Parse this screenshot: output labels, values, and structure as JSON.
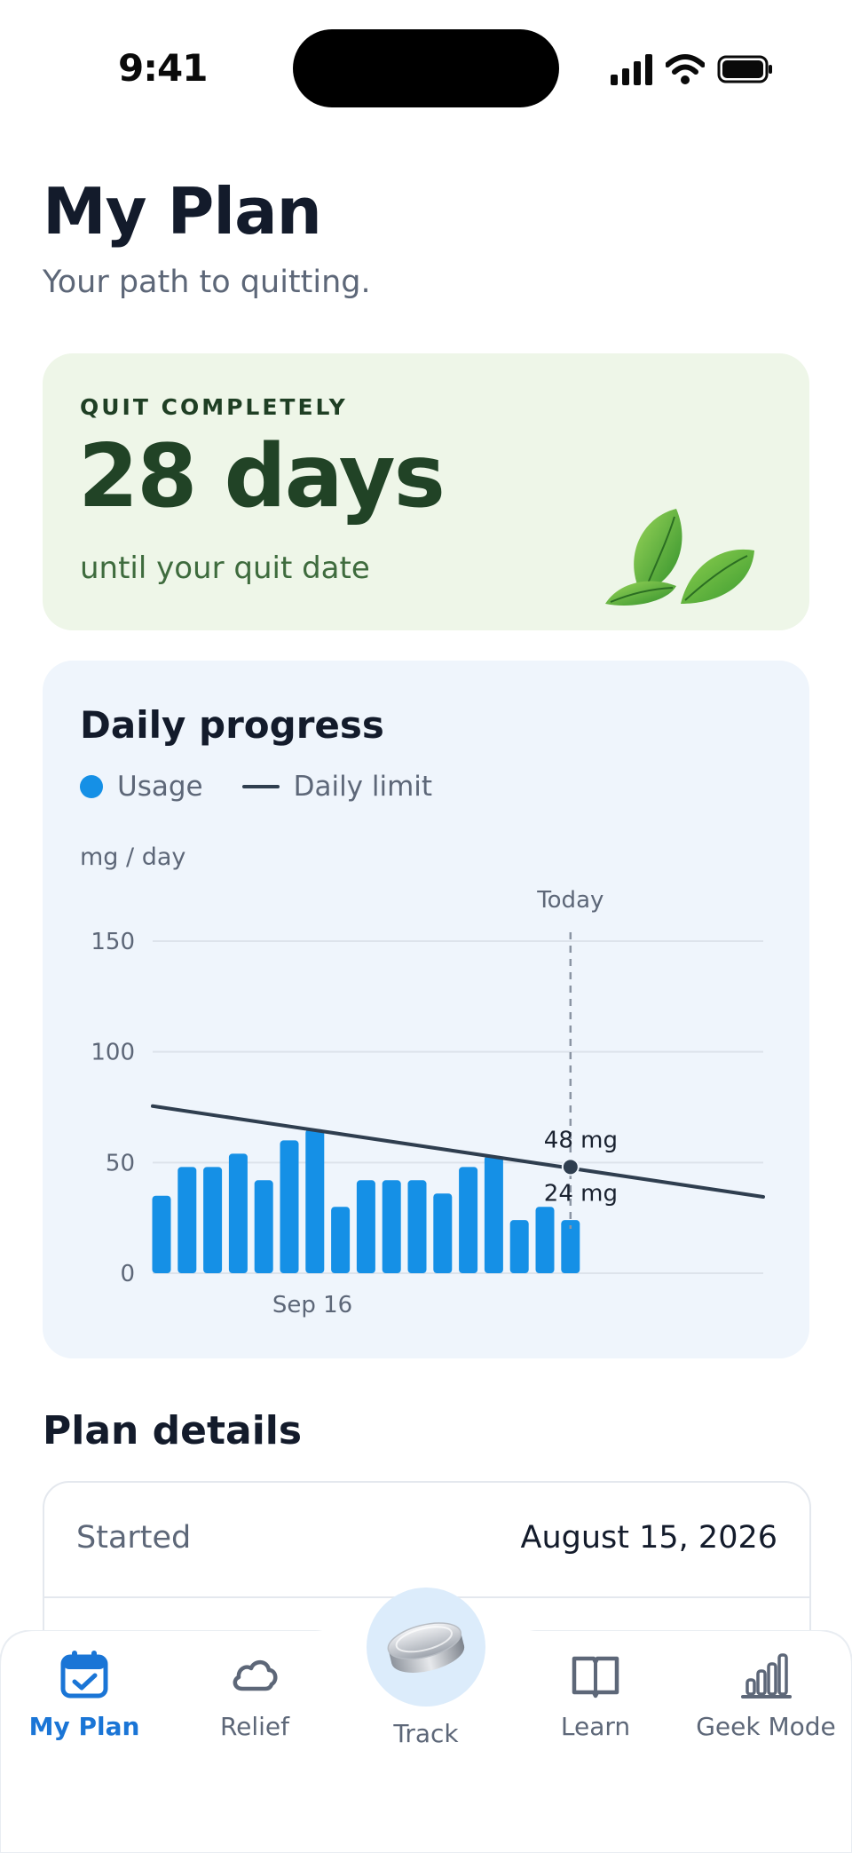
{
  "status_bar": {
    "time": "9:41"
  },
  "header": {
    "title": "My Plan",
    "subtitle": "Your path to quitting."
  },
  "quit_card": {
    "eyebrow": "QUIT COMPLETELY",
    "days": "28 days",
    "caption": "until your quit date",
    "icon": "leaves-icon"
  },
  "progress_card": {
    "title": "Daily progress",
    "legend_usage": "Usage",
    "legend_limit": "Daily limit",
    "unit_label": "mg / day"
  },
  "chart_data": {
    "type": "bar",
    "title": "Daily progress",
    "ylabel": "mg / day",
    "ylim": [
      0,
      150
    ],
    "yticks": [
      0,
      50,
      100,
      150
    ],
    "x_tick_label": "Sep 16",
    "x_tick_index": 5,
    "today_label": "Today",
    "today_index": 16,
    "series": [
      {
        "name": "Usage",
        "type": "bar",
        "color": "#1590e6",
        "values": [
          35,
          48,
          48,
          54,
          42,
          60,
          65,
          30,
          42,
          42,
          42,
          36,
          48,
          53,
          24,
          30,
          24
        ]
      },
      {
        "name": "Daily limit",
        "type": "line",
        "color": "#2f3e4f",
        "start": 75.5,
        "end": 34.5
      }
    ],
    "annotations": [
      {
        "label": "48 mg",
        "value": 48,
        "series": "Daily limit"
      },
      {
        "label": "24 mg",
        "value": 24,
        "series": "Usage"
      }
    ],
    "grid": true
  },
  "plan_details": {
    "title": "Plan details",
    "rows": [
      {
        "key": "Started",
        "value": "August 15, 2026"
      }
    ]
  },
  "tab_bar": {
    "accent": "#1a75d6",
    "tabs": [
      {
        "label": "My Plan",
        "icon": "calendar-check-icon",
        "active": true
      },
      {
        "label": "Relief",
        "icon": "cloud-icon",
        "active": false
      },
      {
        "label": "Track",
        "icon": "pouch-tin-icon",
        "active": false
      },
      {
        "label": "Learn",
        "icon": "book-icon",
        "active": false
      },
      {
        "label": "Geek Mode",
        "icon": "bar-chart-icon",
        "active": false
      }
    ]
  }
}
